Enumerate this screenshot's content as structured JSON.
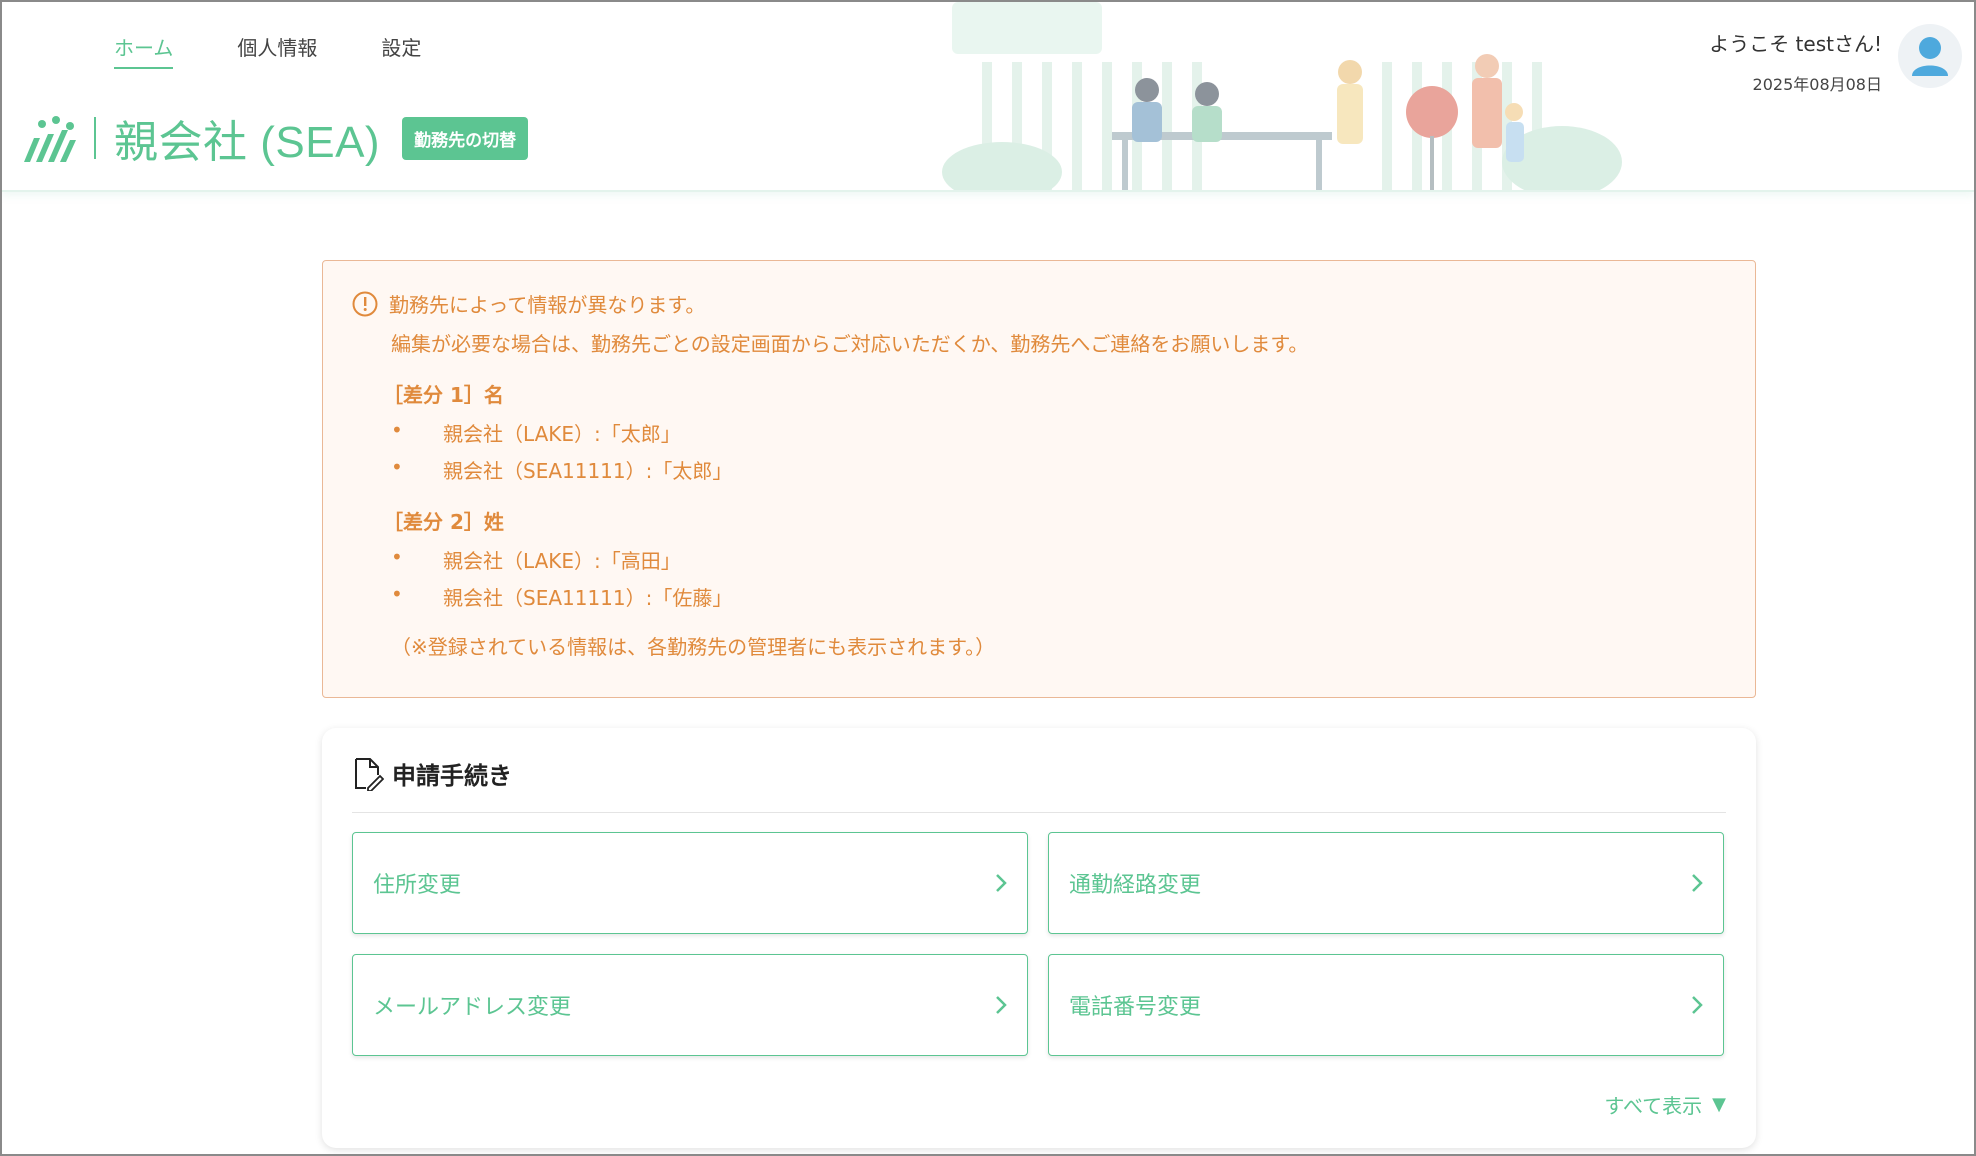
{
  "nav": {
    "items": [
      {
        "label": "ホーム",
        "active": true
      },
      {
        "label": "個人情報",
        "active": false
      },
      {
        "label": "設定",
        "active": false
      }
    ]
  },
  "brand": {
    "company": "親会社 (SEA)",
    "switch_label": "勤務先の切替"
  },
  "user": {
    "greeting": "ようこそ testさん!",
    "date": "2025年08月08日"
  },
  "notice": {
    "line1": "勤務先によって情報が異なります。",
    "line2": "編集が必要な場合は、勤務先ごとの設定画面からご対応いただくか、勤務先へご連絡をお願いします。",
    "diffs": [
      {
        "title": "［差分 1］名",
        "items": [
          "親会社（LAKE）:「太郎」",
          "親会社（SEA11111）:「太郎」"
        ]
      },
      {
        "title": "［差分 2］姓",
        "items": [
          "親会社（LAKE）:「高田」",
          "親会社（SEA11111）:「佐藤」"
        ]
      }
    ],
    "footnote": "（※登録されている情報は、各勤務先の管理者にも表示されます。）"
  },
  "procedures": {
    "title": "申請手続き",
    "tiles": [
      {
        "label": "住所変更"
      },
      {
        "label": "通勤経路変更"
      },
      {
        "label": "メールアドレス変更"
      },
      {
        "label": "電話番号変更"
      }
    ],
    "show_all": "すべて表示"
  },
  "colors": {
    "accent": "#5cc592",
    "notice_text": "#e08a3c",
    "notice_bg": "#fff8f3",
    "notice_border": "#eab896"
  }
}
